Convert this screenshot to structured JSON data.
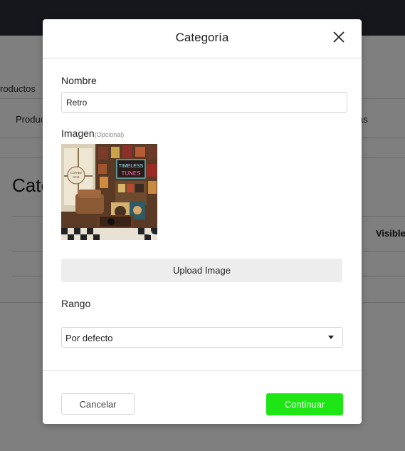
{
  "background": {
    "breadcrumb": "roductos",
    "tab_left": "Produc",
    "tab_right": "as",
    "page_title": "Cate",
    "column_header": "Visible"
  },
  "modal": {
    "title": "Categoría",
    "close_icon": "close-icon",
    "name_label": "Nombre",
    "name_value": "Retro",
    "image_label": "Imagen",
    "image_optional": "(Opcional)",
    "image_sign_1": "TIMELESS",
    "image_sign_2": "TUNES",
    "image_sign_3": "COFFEE",
    "image_sign_4": "STIR",
    "upload_label": "Upload Image",
    "range_label": "Rango",
    "range_value": "Por defecto",
    "cancel_label": "Cancelar",
    "continue_label": "Continuar"
  },
  "colors": {
    "topbar": "#2b2f38",
    "primary": "#1ee614",
    "upload_button": "#ededed"
  }
}
